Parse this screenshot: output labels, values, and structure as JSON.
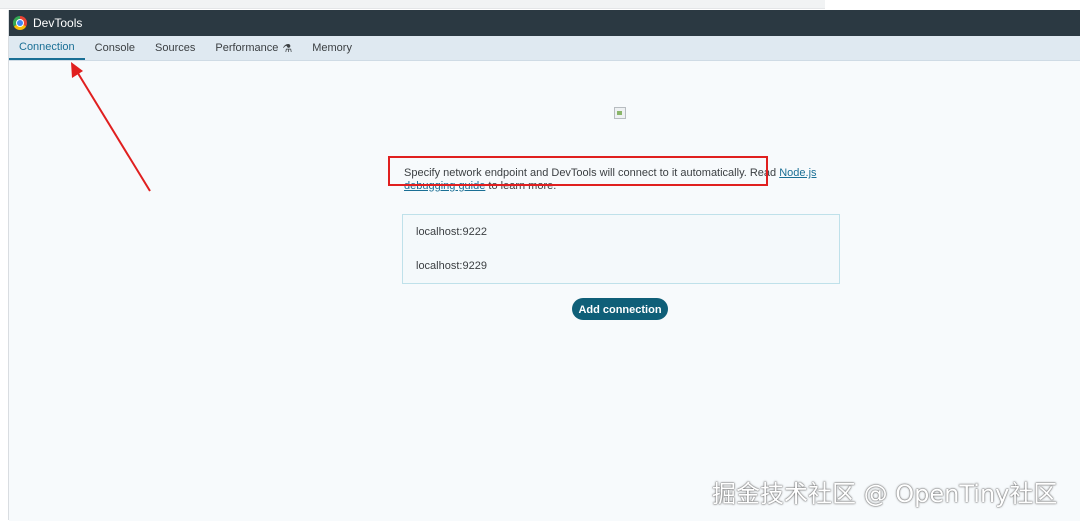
{
  "window": {
    "title": "DevTools"
  },
  "tabs": [
    {
      "label": "Connection"
    },
    {
      "label": "Console"
    },
    {
      "label": "Sources"
    },
    {
      "label": "Performance"
    },
    {
      "label": "Memory"
    }
  ],
  "content": {
    "description": "Specify network endpoint and DevTools will connect to it automatically. Read ",
    "link_text": "Node.js debugging guide",
    "description_suffix": " to learn more.",
    "connections": [
      "localhost:9222",
      "localhost:9229"
    ],
    "add_button": "Add connection"
  },
  "colors": {
    "accent": "#1a6f95",
    "button": "#0f5f78",
    "annotation": "#e01f1f"
  },
  "watermark": "掘金技术社区 @ OpenTiny社区"
}
